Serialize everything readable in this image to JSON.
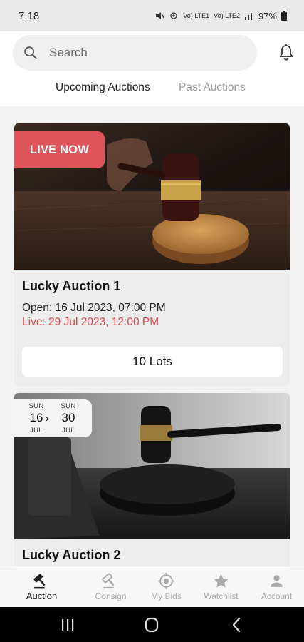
{
  "status_bar": {
    "time": "7:18",
    "signal_text": "Vo) LTE1",
    "signal_text_2": "Vo) LTE2",
    "battery": "97%"
  },
  "header": {
    "search_placeholder": "Search",
    "icons": {
      "search": "search-icon",
      "notifications": "bell-icon"
    }
  },
  "tabs": [
    {
      "label": "Upcoming Auctions",
      "active": true
    },
    {
      "label": "Past Auctions",
      "active": false
    }
  ],
  "auctions": [
    {
      "badge": "LIVE NOW",
      "title": "Lucky Auction 1",
      "open_text": "Open: 16 Jul 2023, 07:00 PM",
      "live_text": "Live: 29 Jul 2023, 12:00 PM",
      "lots_label": "10 Lots"
    },
    {
      "date_badge": {
        "start_day": "SUN",
        "start_date": "16",
        "start_month": "JUL",
        "end_day": "SUN",
        "end_date": "30",
        "end_month": "JUL",
        "separator": "›"
      },
      "title": "Lucky Auction 2"
    }
  ],
  "bottom_nav": [
    {
      "label": "Auction",
      "icon": "gavel-icon",
      "active": true
    },
    {
      "label": "Consign",
      "icon": "gavel-outline-icon",
      "active": false
    },
    {
      "label": "My Bids",
      "icon": "target-icon",
      "active": false
    },
    {
      "label": "Watchlist",
      "icon": "star-icon",
      "active": false
    },
    {
      "label": "Account",
      "icon": "person-icon",
      "active": false
    }
  ],
  "colors": {
    "accent_red": "#e0555b",
    "live_text": "#e0474c",
    "background": "#f2f2f2"
  }
}
